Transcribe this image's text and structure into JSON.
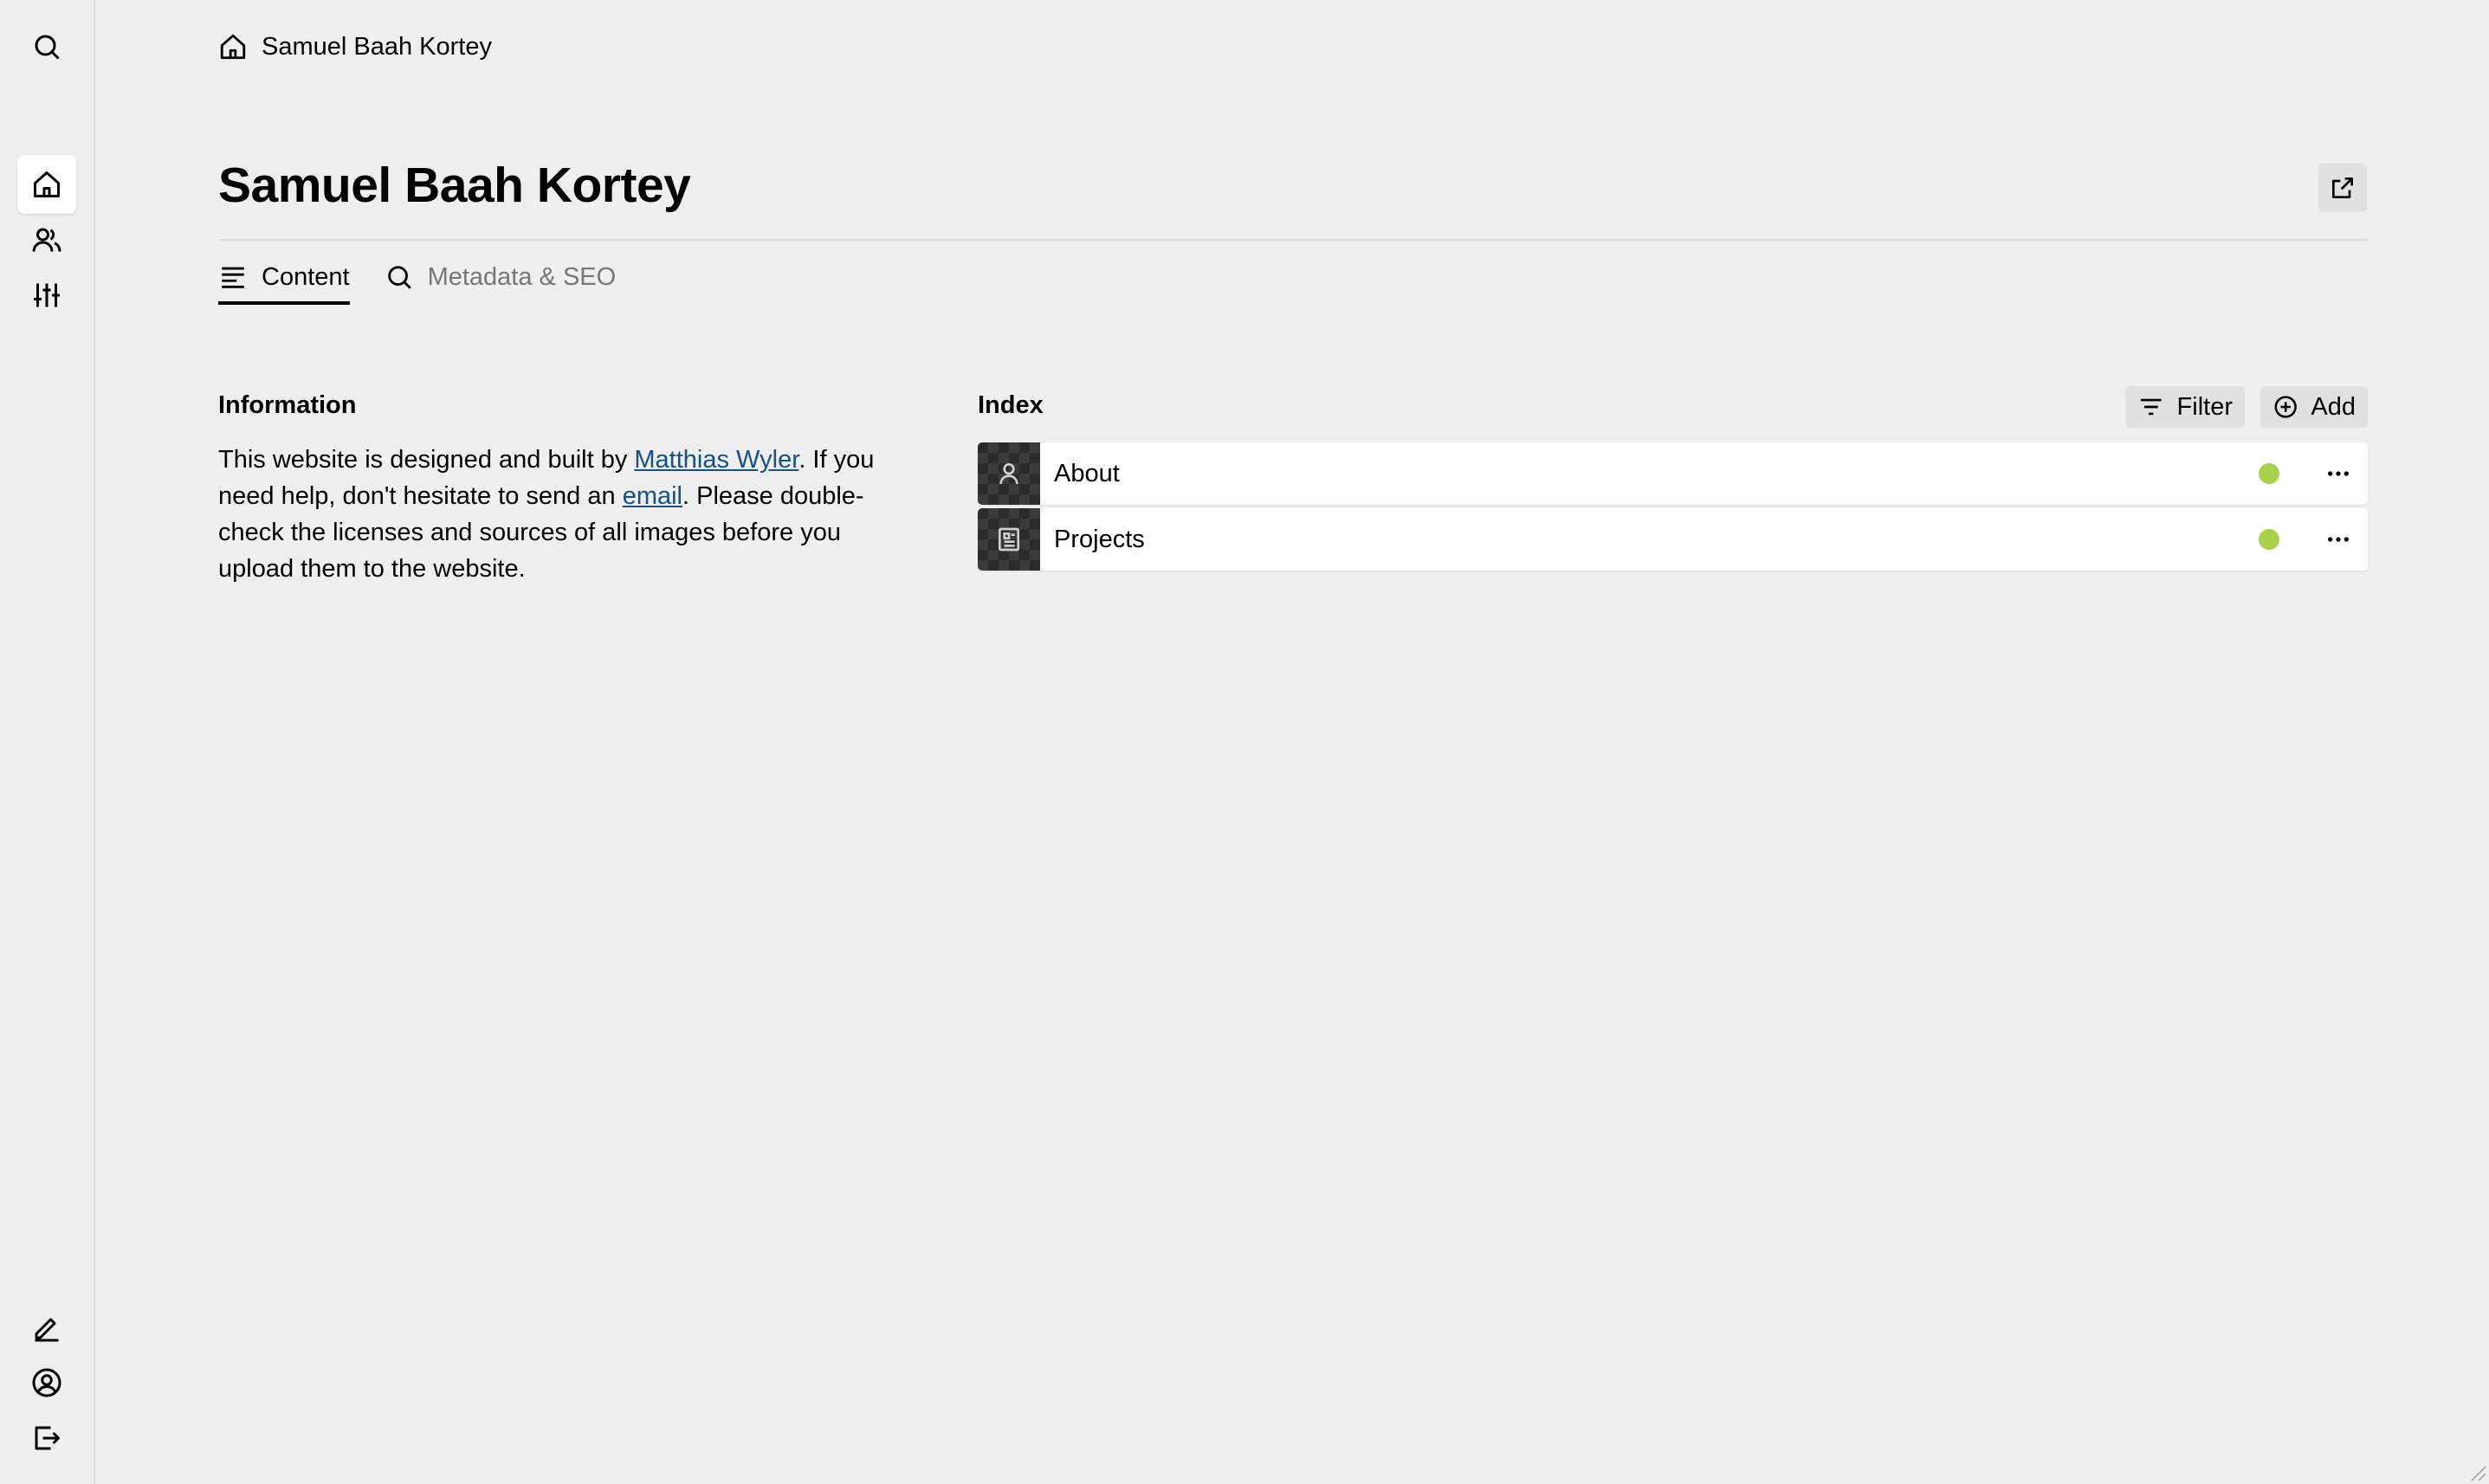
{
  "sidebar": {
    "top": [
      {
        "icon": "search-icon"
      }
    ],
    "nav": [
      {
        "icon": "home-icon",
        "active": true
      },
      {
        "icon": "users-icon",
        "active": false
      },
      {
        "icon": "sliders-icon",
        "active": false
      }
    ],
    "bottom": [
      {
        "icon": "pen-icon"
      },
      {
        "icon": "account-icon"
      },
      {
        "icon": "logout-icon"
      }
    ]
  },
  "breadcrumb": {
    "icon": "home-icon",
    "label": "Samuel Baah Kortey"
  },
  "page": {
    "title": "Samuel Baah Kortey",
    "open_icon": "external-link-icon",
    "tabs": [
      {
        "label": "Content",
        "icon": "text-lines-icon",
        "active": true
      },
      {
        "label": "Metadata & SEO",
        "icon": "search-icon",
        "active": false
      }
    ]
  },
  "info": {
    "title": "Information",
    "text_1": "This website is designed and built by ",
    "link_1": "Matthias Wyler",
    "text_2": ". If you need help, don't hesitate to send an ",
    "link_2": "email",
    "text_3": ". Please double-check the licenses and sources of all images before you upload them to the website."
  },
  "index": {
    "title": "Index",
    "filter_label": "Filter",
    "add_label": "Add",
    "status_color": "#a7d14a",
    "items": [
      {
        "label": "About",
        "icon": "user-icon",
        "status": "published"
      },
      {
        "label": "Projects",
        "icon": "page-icon",
        "status": "published"
      }
    ]
  }
}
